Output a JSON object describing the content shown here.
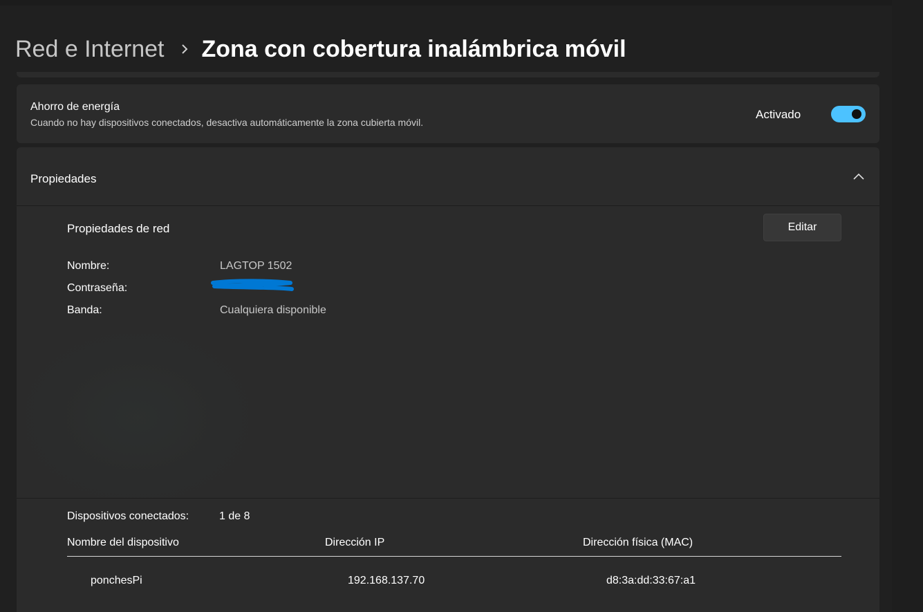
{
  "breadcrumb": {
    "parent": "Red e Internet",
    "current": "Zona con cobertura inalámbrica móvil"
  },
  "power_saving": {
    "title": "Ahorro de energía",
    "description": "Cuando no hay dispositivos conectados, desactiva automáticamente la zona cubierta móvil.",
    "status": "Activado",
    "toggle_on": true
  },
  "properties": {
    "title": "Propiedades",
    "expanded": true,
    "network_title": "Propiedades de red",
    "edit_label": "Editar",
    "fields": [
      {
        "label": "Nombre:",
        "value": "LAGTOP 1502"
      },
      {
        "label": "Contraseña:",
        "value": ""
      },
      {
        "label": "Banda:",
        "value": "Cualquiera disponible"
      }
    ]
  },
  "devices": {
    "label": "Dispositivos conectados:",
    "count": "1 de 8",
    "columns": [
      "Nombre del dispositivo",
      "Dirección IP",
      "Dirección física (MAC)"
    ],
    "rows": [
      [
        "ponchesPi",
        "192.168.137.70",
        "d8:3a:dd:33:67:a1"
      ]
    ]
  },
  "colors": {
    "accent": "#4cc2ff",
    "background": "#202020",
    "card": "#2b2b2b",
    "redaction": "#0078d4"
  },
  "icons": {
    "breadcrumb_separator": "chevron-right-icon",
    "collapse": "chevron-up-icon"
  }
}
